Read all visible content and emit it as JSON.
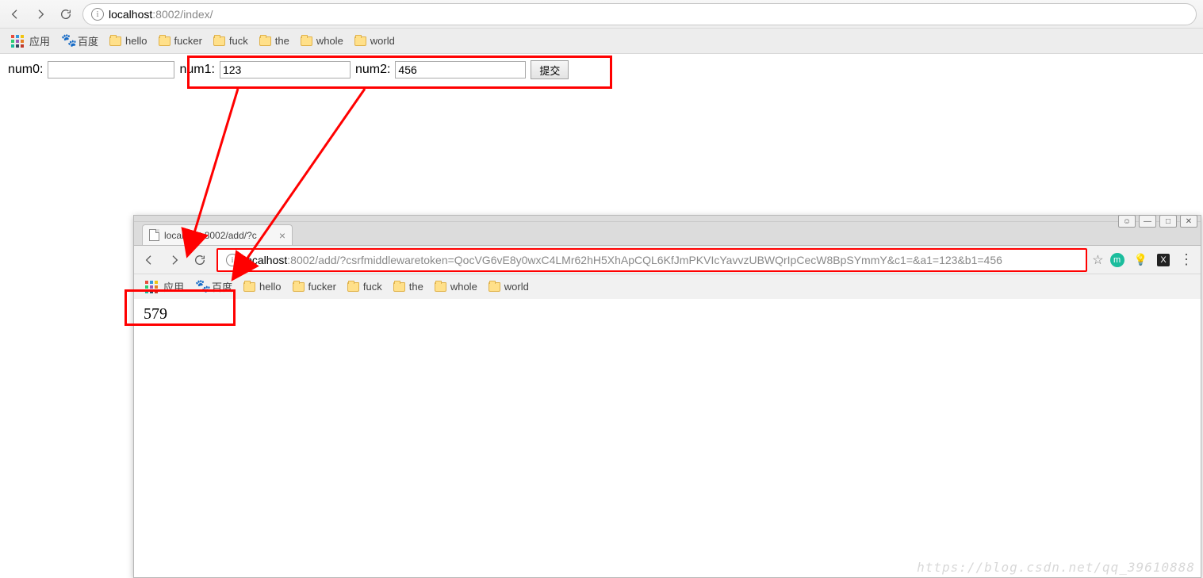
{
  "top_window": {
    "url_host": "localhost",
    "url_rest": ":8002/index/",
    "bookmarks": {
      "apps": "应用",
      "baidu": "百度",
      "items": [
        "hello",
        "fucker",
        "fuck",
        "the",
        "whole",
        "world"
      ]
    },
    "form": {
      "label_num0": "num0:",
      "label_num1": "num1:",
      "label_num2": "num2:",
      "value_num0": "",
      "value_num1": "123",
      "value_num2": "456",
      "submit_label": "提交"
    }
  },
  "second_window": {
    "tab_title": "localhost:8002/add/?c",
    "url_host": "localhost",
    "url_rest": ":8002/add/?csrfmiddlewaretoken=QocVG6vE8y0wxC4LMr62hH5XhApCQL6KfJmPKVIcYavvzUBWQrIpCecW8BpSYmmY&c1=&a1=123&b1=456",
    "bookmarks": {
      "apps": "应用",
      "baidu": "百度",
      "items": [
        "hello",
        "fucker",
        "fuck",
        "the",
        "whole",
        "world"
      ]
    },
    "result_text": "579"
  },
  "watermark": "https://blog.csdn.net/qq_39610888",
  "window_controls": {
    "person": "☺",
    "min": "—",
    "max": "□",
    "close": "✕"
  }
}
